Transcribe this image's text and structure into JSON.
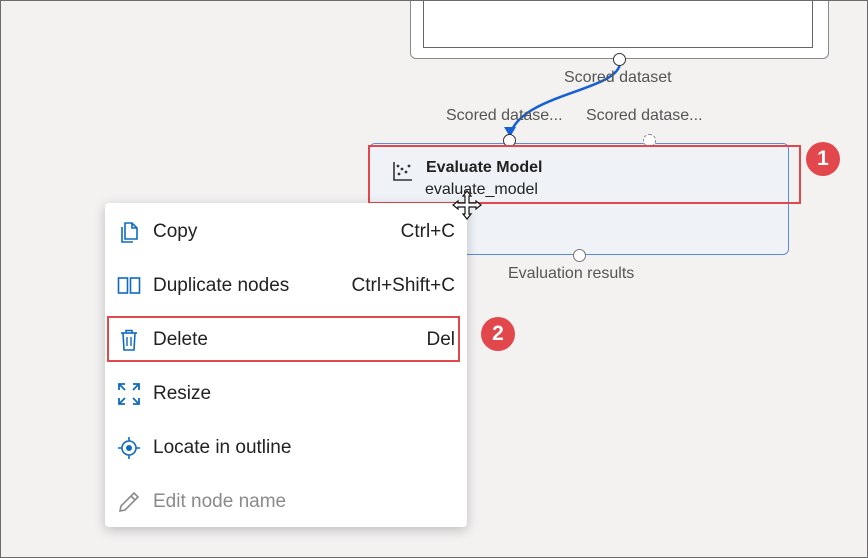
{
  "canvas": {
    "top_node_output_label": "Scored dataset",
    "eval_input_label_1": "Scored datase...",
    "eval_input_label_2": "Scored datase...",
    "eval_output_label": "Evaluation results"
  },
  "eval_node": {
    "title": "Evaluate Model",
    "subtitle": "evaluate_model",
    "icon": "scatter-chart-icon"
  },
  "callouts": {
    "badge_1": "1",
    "badge_2": "2"
  },
  "context_menu": {
    "items": [
      {
        "label": "Copy",
        "shortcut": "Ctrl+C",
        "icon": "copy-icon"
      },
      {
        "label": "Duplicate nodes",
        "shortcut": "Ctrl+Shift+C",
        "icon": "duplicate-icon"
      },
      {
        "label": "Delete",
        "shortcut": "Del",
        "icon": "trash-icon"
      },
      {
        "label": "Resize",
        "shortcut": "",
        "icon": "resize-icon"
      },
      {
        "label": "Locate in outline",
        "shortcut": "",
        "icon": "locate-icon"
      },
      {
        "label": "Edit node name",
        "shortcut": "",
        "icon": "pencil-icon",
        "disabled": true
      }
    ]
  },
  "colors": {
    "accent": "#0f6cbd",
    "callout": "#e2474b",
    "node_border": "#5b8cdb",
    "node_bg": "#eff3f8"
  }
}
